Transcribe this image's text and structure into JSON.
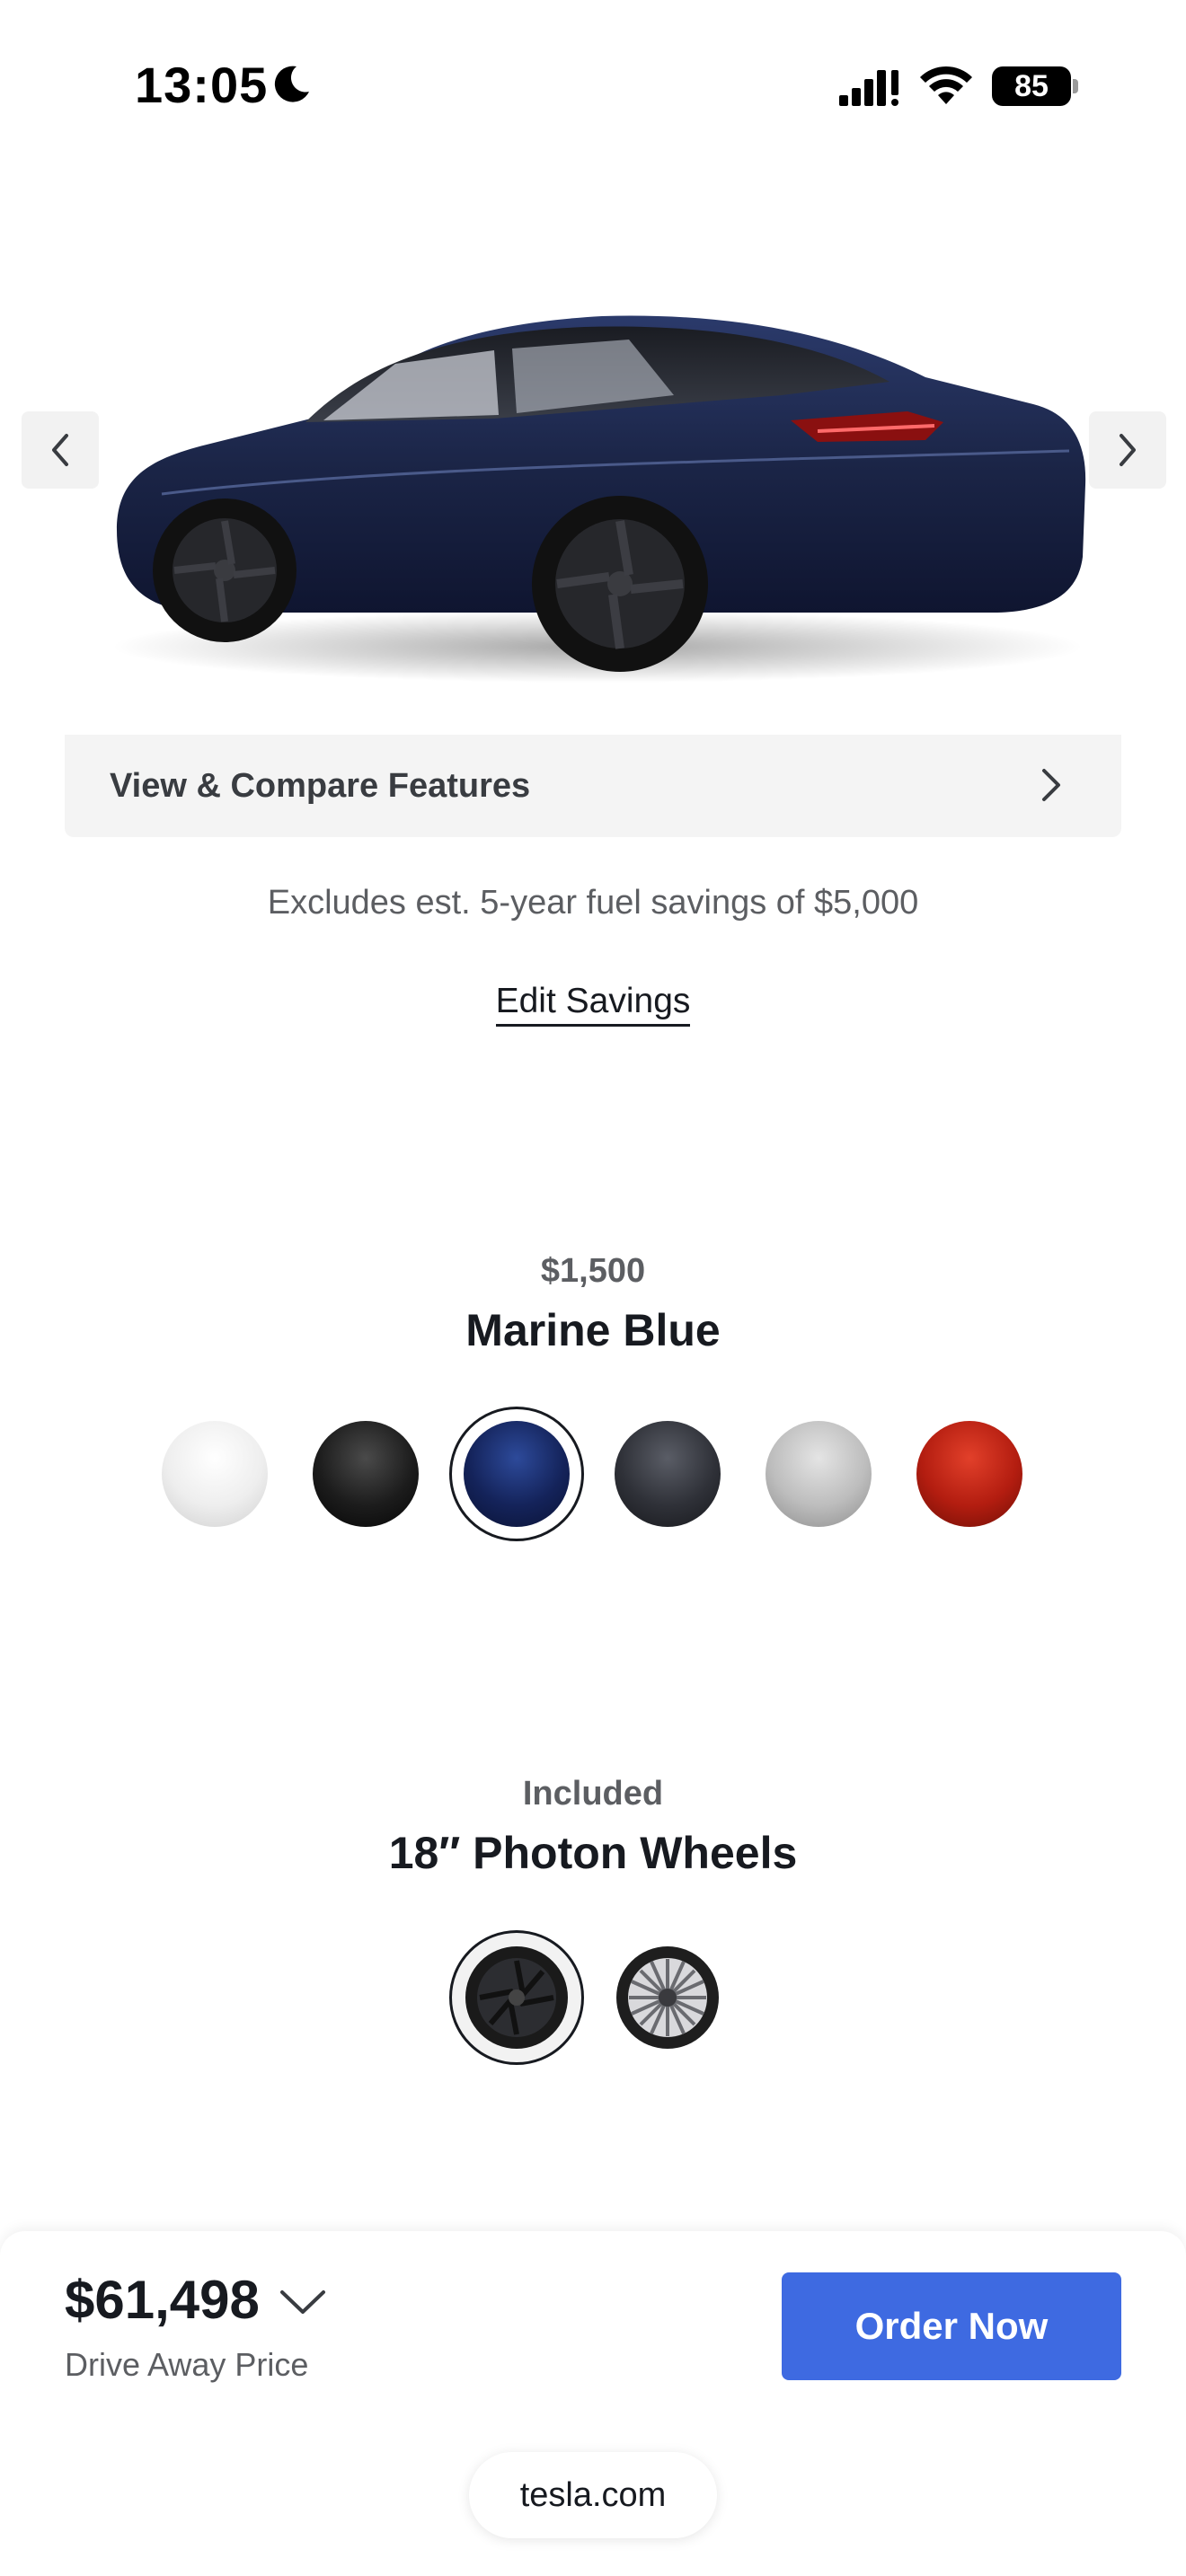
{
  "status_bar": {
    "time": "13:05",
    "battery_level": "85",
    "icons": [
      "moon-icon",
      "signal-icon",
      "wifi-icon",
      "battery-icon"
    ]
  },
  "hero": {
    "car_image": "car-image",
    "paint_color": "#1b2547"
  },
  "compare": {
    "label": "View & Compare Features"
  },
  "savings": {
    "text": "Excludes est. 5-year fuel savings of $5,000",
    "edit_label": "Edit Savings"
  },
  "paint": {
    "price": "$1,500",
    "name": "Marine Blue",
    "options": [
      {
        "name": "white",
        "color": "#f2f2f2"
      },
      {
        "name": "black",
        "color": "#1c1c1c"
      },
      {
        "name": "marine-blue",
        "color": "#14235a",
        "selected": true
      },
      {
        "name": "stealth-grey",
        "color": "#2f3138"
      },
      {
        "name": "silver",
        "color": "#bdbdbd"
      },
      {
        "name": "red",
        "color": "#b31d10"
      }
    ]
  },
  "wheels": {
    "price": "Included",
    "name": "18″ Photon Wheels",
    "options": [
      {
        "name": "photon-wheel",
        "selected": true
      },
      {
        "name": "nova-wheel",
        "selected": false
      }
    ]
  },
  "footer": {
    "price": "$61,498",
    "price_label": "Drive Away Price",
    "order_label": "Order Now",
    "url": "tesla.com",
    "accent_color": "#3e6ae1"
  }
}
